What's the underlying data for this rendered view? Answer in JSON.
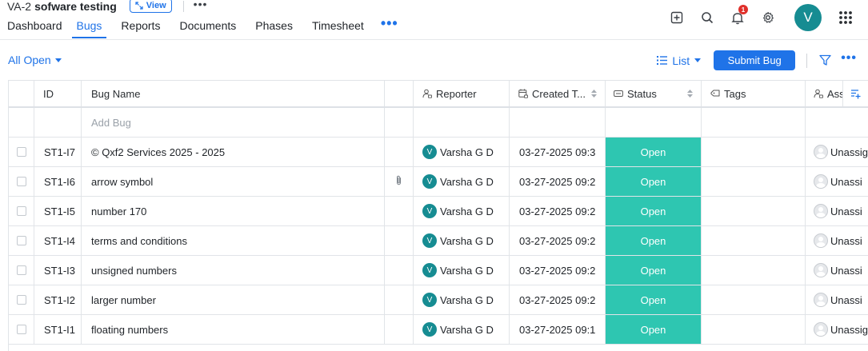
{
  "project": {
    "id": "VA-2",
    "name": "sofware testing",
    "view_label": "View",
    "more": "•••"
  },
  "tabs": [
    {
      "label": "Dashboard",
      "active": false
    },
    {
      "label": "Bugs",
      "active": true
    },
    {
      "label": "Reports",
      "active": false
    },
    {
      "label": "Documents",
      "active": false
    },
    {
      "label": "Phases",
      "active": false
    },
    {
      "label": "Timesheet",
      "active": false
    }
  ],
  "tabs_more": "•••",
  "top_icons": {
    "notification_count": "1",
    "avatar_initial": "V"
  },
  "toolbar": {
    "filter_label": "All Open",
    "list_label": "List",
    "submit_label": "Submit Bug",
    "more": "•••"
  },
  "table": {
    "columns": {
      "id": "ID",
      "bug_name": "Bug Name",
      "reporter": "Reporter",
      "created": "Created T...",
      "status": "Status",
      "tags": "Tags",
      "assignee": "Ass"
    },
    "add_placeholder": "Add Bug",
    "rows": [
      {
        "id": "ST1-I7",
        "name": "© Qxf2 Services 2025 - 2025",
        "attachment": false,
        "reporter": "Varsha G D",
        "reporter_initial": "V",
        "created": "03-27-2025 09:3",
        "status": "Open",
        "tags": "",
        "assignee": "Unassig"
      },
      {
        "id": "ST1-I6",
        "name": "arrow symbol",
        "attachment": true,
        "reporter": "Varsha G D",
        "reporter_initial": "V",
        "created": "03-27-2025 09:2",
        "status": "Open",
        "tags": "",
        "assignee": "Unassi"
      },
      {
        "id": "ST1-I5",
        "name": "number 170",
        "attachment": false,
        "reporter": "Varsha G D",
        "reporter_initial": "V",
        "created": "03-27-2025 09:2",
        "status": "Open",
        "tags": "",
        "assignee": "Unassi"
      },
      {
        "id": "ST1-I4",
        "name": "terms and conditions",
        "attachment": false,
        "reporter": "Varsha G D",
        "reporter_initial": "V",
        "created": "03-27-2025 09:2",
        "status": "Open",
        "tags": "",
        "assignee": "Unassi"
      },
      {
        "id": "ST1-I3",
        "name": "unsigned numbers",
        "attachment": false,
        "reporter": "Varsha G D",
        "reporter_initial": "V",
        "created": "03-27-2025 09:2",
        "status": "Open",
        "tags": "",
        "assignee": "Unassi"
      },
      {
        "id": "ST1-I2",
        "name": "larger number",
        "attachment": false,
        "reporter": "Varsha G D",
        "reporter_initial": "V",
        "created": "03-27-2025 09:2",
        "status": "Open",
        "tags": "",
        "assignee": "Unassi"
      },
      {
        "id": "ST1-I1",
        "name": "floating numbers",
        "attachment": false,
        "reporter": "Varsha G D",
        "reporter_initial": "V",
        "created": "03-27-2025 09:1",
        "status": "Open",
        "tags": "",
        "assignee": "Unassig"
      }
    ]
  },
  "colors": {
    "accent": "#1f73e8",
    "status_open": "#2ec6b1",
    "avatar": "#168c92",
    "notification": "#e0302b"
  }
}
